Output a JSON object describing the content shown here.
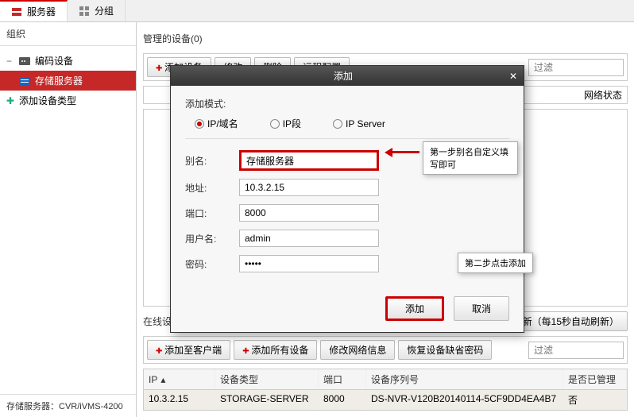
{
  "tabs": {
    "server": "服务器",
    "group": "分组"
  },
  "sidebar": {
    "title": "组织",
    "items": [
      {
        "label": "编码设备"
      },
      {
        "label": "存储服务器"
      },
      {
        "label": "添加设备类型"
      }
    ],
    "status": "存储服务器：CVR/iVMS-4200"
  },
  "managed": {
    "title": "管理的设备(0)",
    "toolbar": {
      "add": "添加设备",
      "modify": "修改",
      "delete": "删除",
      "remote": "远程配置"
    },
    "filter_ph": "过滤",
    "net_status_col": "网络状态"
  },
  "online": {
    "title": "在线设备(1)",
    "refresh": "刷新（每15秒自动刷新）",
    "toolbar": {
      "add_client": "添加至客户端",
      "add_all": "添加所有设备",
      "modify_net": "修改网络信息",
      "restore_pwd": "恢复设备缺省密码"
    },
    "filter_ph": "过滤",
    "cols": {
      "ip": "IP",
      "type": "设备类型",
      "port": "端口",
      "serial": "设备序列号",
      "managed": "是否已管理"
    },
    "row": {
      "ip": "10.3.2.15",
      "type": "STORAGE-SERVER",
      "port": "8000",
      "serial": "DS-NVR-V120B20140114-5CF9DD4EA4B7",
      "managed": "否"
    }
  },
  "dialog": {
    "title": "添加",
    "mode_label": "添加模式:",
    "modes": {
      "ip_domain": "IP/域名",
      "ip_segment": "IP段",
      "ip_server": "IP Server"
    },
    "fields": {
      "alias": {
        "label": "别名:",
        "value": "存储服务器"
      },
      "addr": {
        "label": "地址:",
        "value": "10.3.2.15"
      },
      "port": {
        "label": "端口:",
        "value": "8000"
      },
      "user": {
        "label": "用户名:",
        "value": "admin"
      },
      "pwd": {
        "label": "密码:",
        "value": "•••••"
      }
    },
    "actions": {
      "add": "添加",
      "cancel": "取消"
    }
  },
  "callouts": {
    "step1": "第一步别名自定义填写即可",
    "step2": "第二步点击添加"
  }
}
